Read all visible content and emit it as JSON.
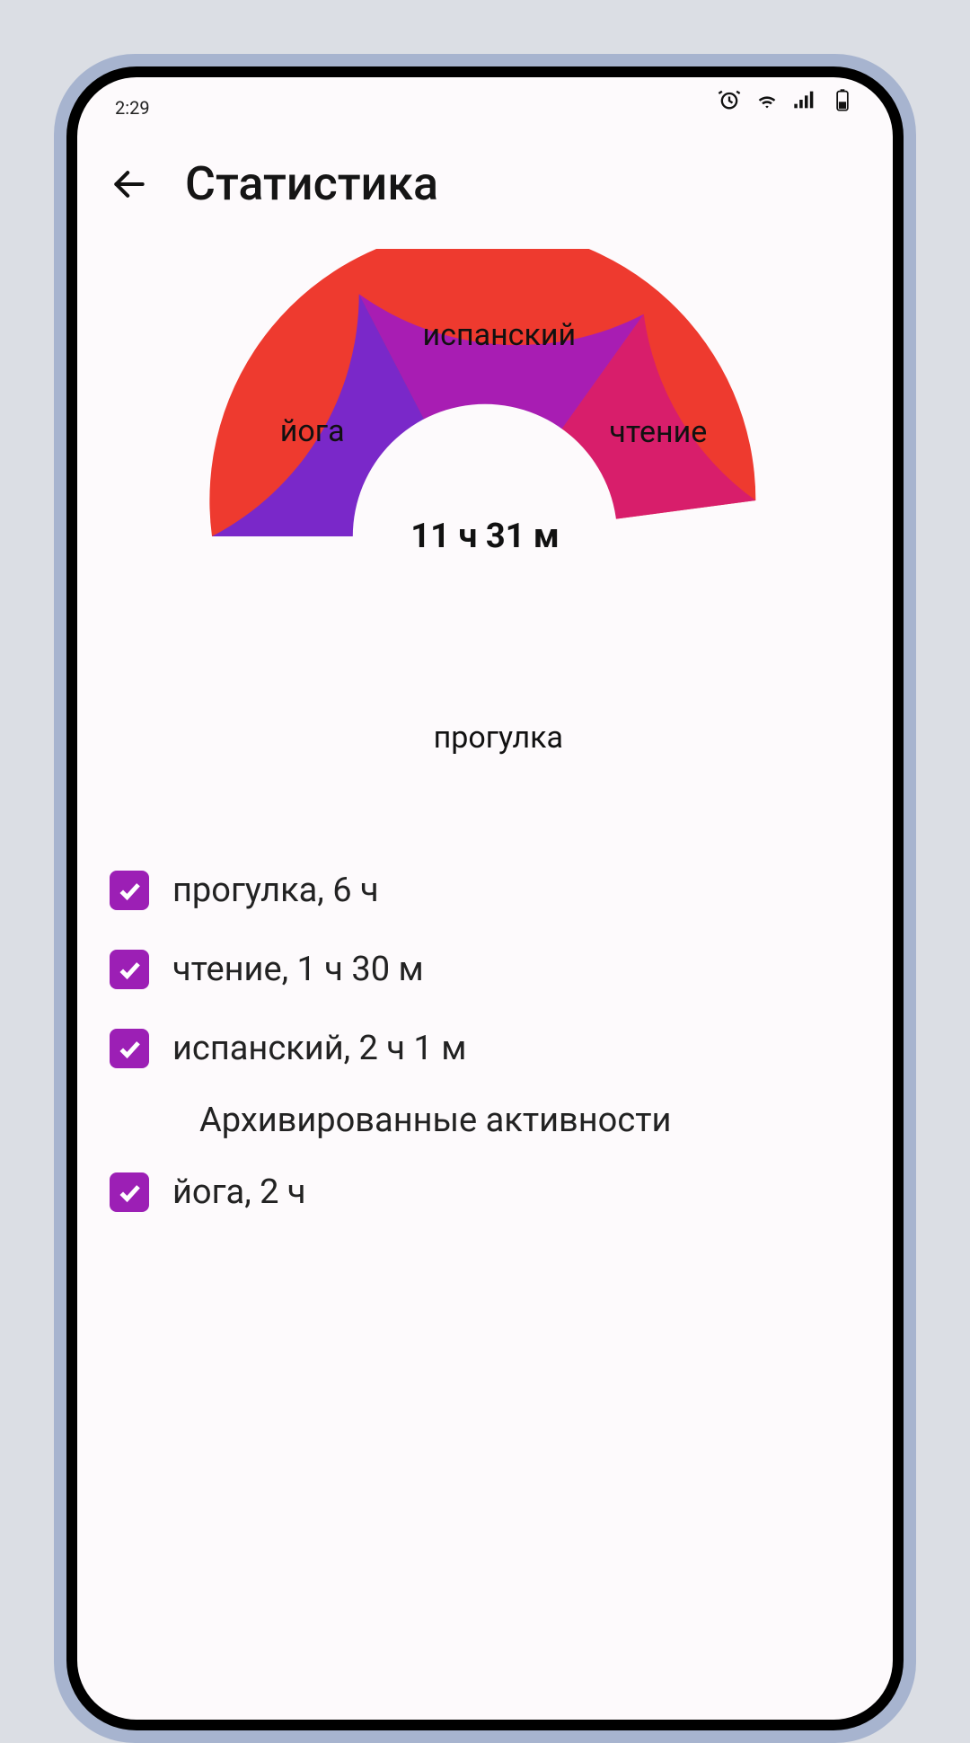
{
  "status_bar": {
    "time": "2:29"
  },
  "header": {
    "title": "Статистика"
  },
  "chart_data": {
    "type": "pie",
    "title": "",
    "center_label": "11 ч 31 м",
    "total_minutes": 691,
    "series": [
      {
        "name": "прогулка",
        "label": "прогулка",
        "minutes": 360,
        "color": "#ee3a2f"
      },
      {
        "name": "чтение",
        "label": "чтение",
        "minutes": 90,
        "color": "#d81e6b"
      },
      {
        "name": "испанский",
        "label": "испанский",
        "minutes": 121,
        "color": "#a81db3"
      },
      {
        "name": "йога",
        "label": "йога",
        "minutes": 120,
        "color": "#7a28c9"
      }
    ]
  },
  "legend": {
    "items": [
      {
        "label": "прогулка, 6 ч",
        "checked": true
      },
      {
        "label": "чтение, 1 ч 30 м",
        "checked": true
      },
      {
        "label": "испанский, 2 ч 1 м",
        "checked": true
      }
    ],
    "archived_header": "Архивированные активности",
    "archived_items": [
      {
        "label": "йога, 2 ч",
        "checked": true
      }
    ]
  },
  "colors": {
    "checkbox": "#9c1fb5"
  }
}
